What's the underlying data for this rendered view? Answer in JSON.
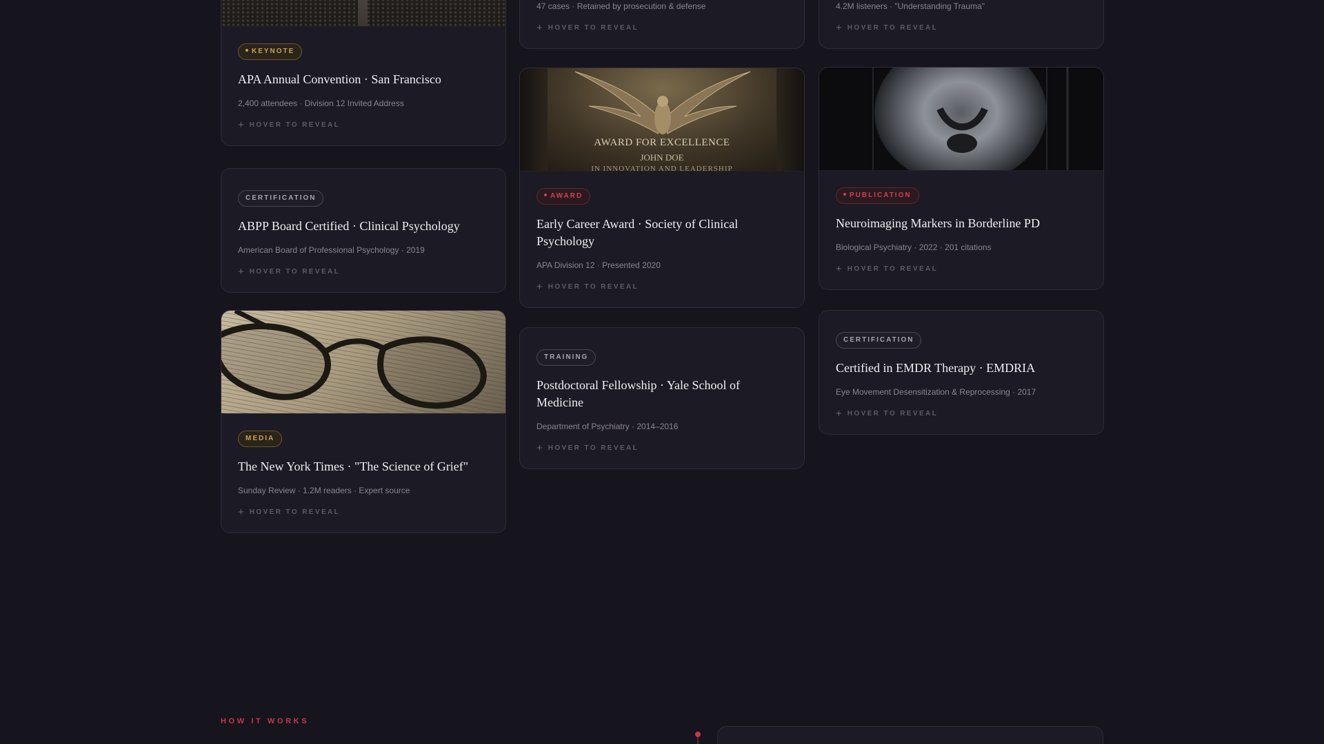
{
  "reveal_label": "HOVER TO REVEAL",
  "colors": {
    "background": "#16141d",
    "card": "#1c1a24",
    "accent_gold": "#c9a154",
    "accent_red": "#c23a4a"
  },
  "cards": {
    "apa": {
      "badge": "KEYNOTE",
      "title": "APA Annual Convention · San Francisco",
      "meta": "2,400 attendees · Division 12 Invited Address"
    },
    "forensic": {
      "meta": "47 cases · Retained by prosecution & defense"
    },
    "podcast": {
      "meta": "4.2M listeners · \"Understanding Trauma\""
    },
    "abpp": {
      "badge": "CERTIFICATION",
      "title": "ABPP Board Certified · Clinical Psychology",
      "meta": "American Board of Professional Psychology · 2019"
    },
    "award": {
      "image_text_1": "AWARD FOR EXCELLENCE",
      "image_text_2": "JOHN DOE",
      "image_text_3": "IN INNOVATION AND LEADERSHIP",
      "badge": "AWARD",
      "title": "Early Career Award · Society of Clinical Psychology",
      "meta": "APA Division 12 · Presented 2020"
    },
    "neuro": {
      "badge": "PUBLICATION",
      "title": "Neuroimaging Markers in Borderline PD",
      "meta": "Biological Psychiatry · 2022 · 201 citations"
    },
    "fellowship": {
      "badge": "TRAINING",
      "title": "Postdoctoral Fellowship · Yale School of Medicine",
      "meta": "Department of Psychiatry · 2014–2016"
    },
    "emdr": {
      "badge": "CERTIFICATION",
      "title": "Certified in EMDR Therapy · EMDRIA",
      "meta": "Eye Movement Desensitization & Reprocessing · 2017"
    },
    "nyt": {
      "badge": "MEDIA",
      "title": "The New York Times · \"The Science of Grief\"",
      "meta": "Sunday Review · 1.2M readers · Expert source"
    }
  },
  "how_it_works": {
    "label": "HOW IT WORKS"
  }
}
